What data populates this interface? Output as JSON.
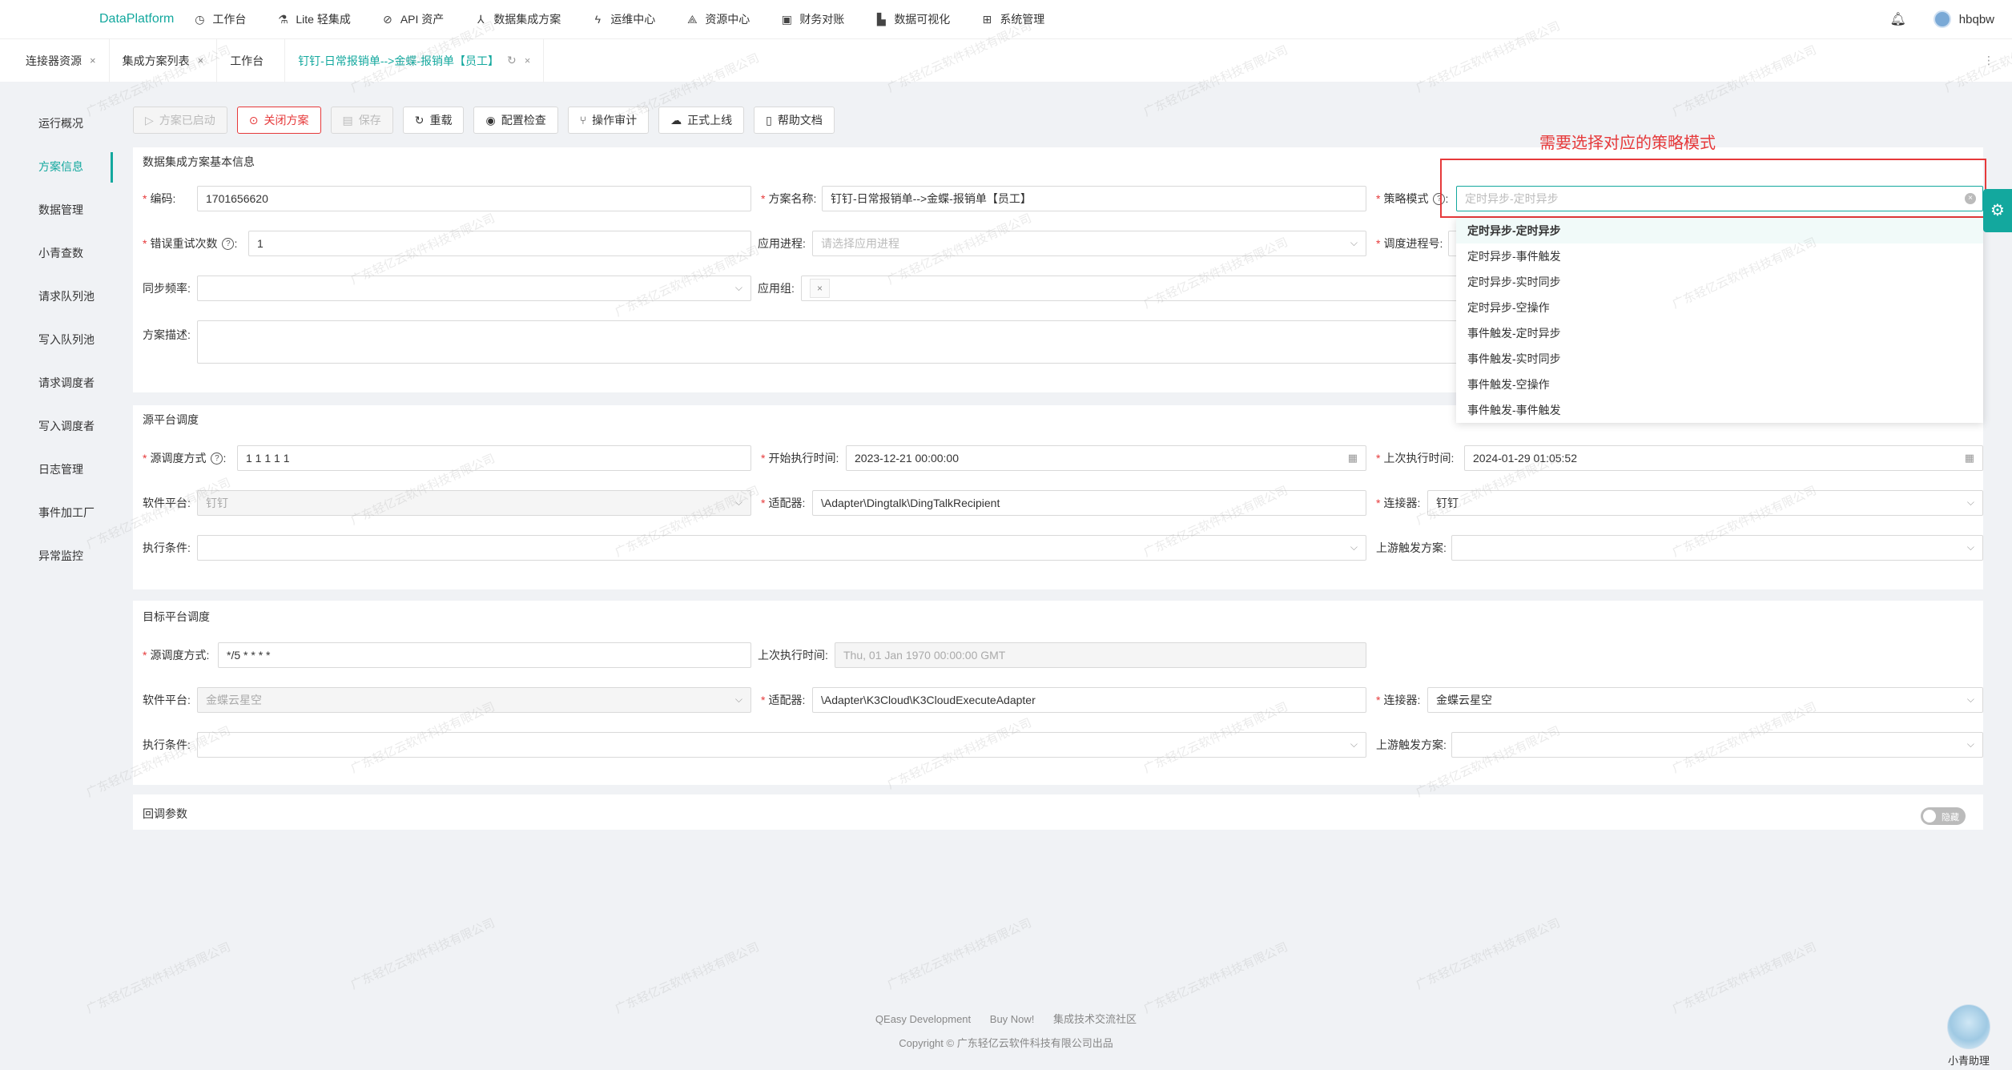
{
  "topnav": {
    "brand": "DataPlatform",
    "items": [
      {
        "label": "工作台",
        "icon": "dashboard-icon"
      },
      {
        "label": "Lite 轻集成",
        "icon": "lite-icon"
      },
      {
        "label": "API 资产",
        "icon": "api-icon"
      },
      {
        "label": "数据集成方案",
        "icon": "integration-icon"
      },
      {
        "label": "运维中心",
        "icon": "ops-icon"
      },
      {
        "label": "资源中心",
        "icon": "resource-icon"
      },
      {
        "label": "财务对账",
        "icon": "finance-icon"
      },
      {
        "label": "数据可视化",
        "icon": "chart-icon"
      },
      {
        "label": "系统管理",
        "icon": "system-icon"
      }
    ],
    "username": "hbqbw"
  },
  "tabs": [
    {
      "label": "连接器资源"
    },
    {
      "label": "集成方案列表"
    },
    {
      "label": "工作台"
    },
    {
      "label": "钉钉-日常报销单-->金蝶-报销单【员工】"
    }
  ],
  "side": {
    "items": [
      "运行概况",
      "方案信息",
      "数据管理",
      "小青查数",
      "请求队列池",
      "写入队列池",
      "请求调度者",
      "写入调度者",
      "日志管理",
      "事件加工厂",
      "异常监控"
    ]
  },
  "toolbar": {
    "started": "方案已启动",
    "close": "关闭方案",
    "save": "保存",
    "reload": "重载",
    "config_check": "配置检查",
    "audit": "操作审计",
    "publish": "正式上线",
    "help": "帮助文档"
  },
  "basic": {
    "title": "数据集成方案基本信息",
    "code_label": "编码:",
    "code_value": "1701656620",
    "name_label": "方案名称:",
    "name_value": "钉钉-日常报销单-->金蝶-报销单【员工】",
    "strategy_label": "策略模式",
    "strategy_placeholder": "定时异步-定时异步",
    "retry_label": "错误重试次数",
    "retry_value": "1",
    "app_process_label": "应用进程:",
    "app_process_placeholder": "请选择应用进程",
    "schedule_no_label": "调度进程号:",
    "sync_freq_label": "同步频率:",
    "app_group_label": "应用组:",
    "app_group_tag": "×",
    "desc_label": "方案描述:"
  },
  "strategy_options": [
    "定时异步-定时异步",
    "定时异步-事件触发",
    "定时异步-实时同步",
    "定时异步-空操作",
    "事件触发-定时异步",
    "事件触发-实时同步",
    "事件触发-空操作",
    "事件触发-事件触发"
  ],
  "annotation": "需要选择对应的策略模式",
  "source": {
    "title": "源平台调度",
    "sched_label": "源调度方式",
    "sched_value": "1 1 1 1 1",
    "start_label": "开始执行时间:",
    "start_value": "2023-12-21 00:00:00",
    "last_label": "上次执行时间:",
    "last_value": "2024-01-29 01:05:52",
    "platform_label": "软件平台:",
    "platform_value": "钉钉",
    "adapter_label": "适配器:",
    "adapter_value": "\\Adapter\\Dingtalk\\DingTalkRecipient",
    "connector_label": "连接器:",
    "connector_value": "钉钉",
    "cond_label": "执行条件:",
    "upstream_label": "上游触发方案:"
  },
  "target": {
    "title": "目标平台调度",
    "sched_label": "源调度方式:",
    "sched_value": "*/5 * * * *",
    "last_label": "上次执行时间:",
    "last_value": "Thu, 01 Jan 1970 00:00:00 GMT",
    "platform_label": "软件平台:",
    "platform_value": "金蝶云星空",
    "adapter_label": "适配器:",
    "adapter_value": "\\Adapter\\K3Cloud\\K3CloudExecuteAdapter",
    "connector_label": "连接器:",
    "connector_value": "金蝶云星空",
    "cond_label": "执行条件:",
    "upstream_label": "上游触发方案:"
  },
  "callback": {
    "title": "回调参数",
    "toggle_label": "隐藏"
  },
  "footer": {
    "links": [
      "QEasy Development",
      "Buy Now!",
      "集成技术交流社区"
    ],
    "copyright": "Copyright © 广东轻亿云软件科技有限公司出品"
  },
  "assistant": "小青助理",
  "watermark": "广东轻亿云软件科技有限公司",
  "colors": {
    "accent": "#13a89e",
    "danger": "#e6393a"
  }
}
